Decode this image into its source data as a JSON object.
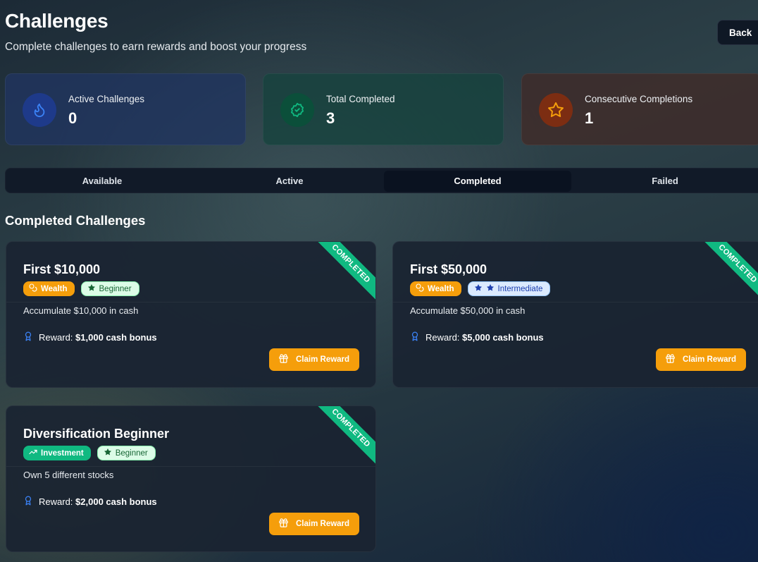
{
  "header": {
    "title": "Challenges",
    "subtitle": "Complete challenges to earn rewards and boost your progress",
    "back_label": "Back"
  },
  "stats": [
    {
      "label": "Active Challenges",
      "value": "0",
      "icon": "flame-icon",
      "color": "#3b82f6"
    },
    {
      "label": "Total Completed",
      "value": "3",
      "icon": "badge-check-icon",
      "color": "#10b981"
    },
    {
      "label": "Consecutive Completions",
      "value": "1",
      "icon": "star-icon",
      "color": "#f59e0b"
    }
  ],
  "tabs": [
    {
      "label": "Available",
      "active": false
    },
    {
      "label": "Active",
      "active": false
    },
    {
      "label": "Completed",
      "active": true
    },
    {
      "label": "Failed",
      "active": false
    }
  ],
  "section_title": "Completed Challenges",
  "challenges": [
    {
      "title": "First $10,000",
      "category": "Wealth",
      "category_icon": "coins-icon",
      "difficulty": "Beginner",
      "difficulty_stars": 1,
      "description": "Accumulate $10,000 in cash",
      "reward_label": "Reward:",
      "reward_value": "$1,000 cash bonus",
      "ribbon": "COMPLETED",
      "claim_label": "Claim Reward"
    },
    {
      "title": "First $50,000",
      "category": "Wealth",
      "category_icon": "coins-icon",
      "difficulty": "Intermediate",
      "difficulty_stars": 2,
      "description": "Accumulate $50,000 in cash",
      "reward_label": "Reward:",
      "reward_value": "$5,000 cash bonus",
      "ribbon": "COMPLETED",
      "claim_label": "Claim Reward"
    },
    {
      "title": "Diversification Beginner",
      "category": "Investment",
      "category_icon": "trending-up-icon",
      "difficulty": "Beginner",
      "difficulty_stars": 1,
      "description": "Own 5 different stocks",
      "reward_label": "Reward:",
      "reward_value": "$2,000 cash bonus",
      "ribbon": "COMPLETED",
      "claim_label": "Claim Reward"
    }
  ],
  "colors": {
    "accent_orange": "#f59e0b",
    "accent_green": "#10b981",
    "accent_blue": "#3b82f6"
  }
}
